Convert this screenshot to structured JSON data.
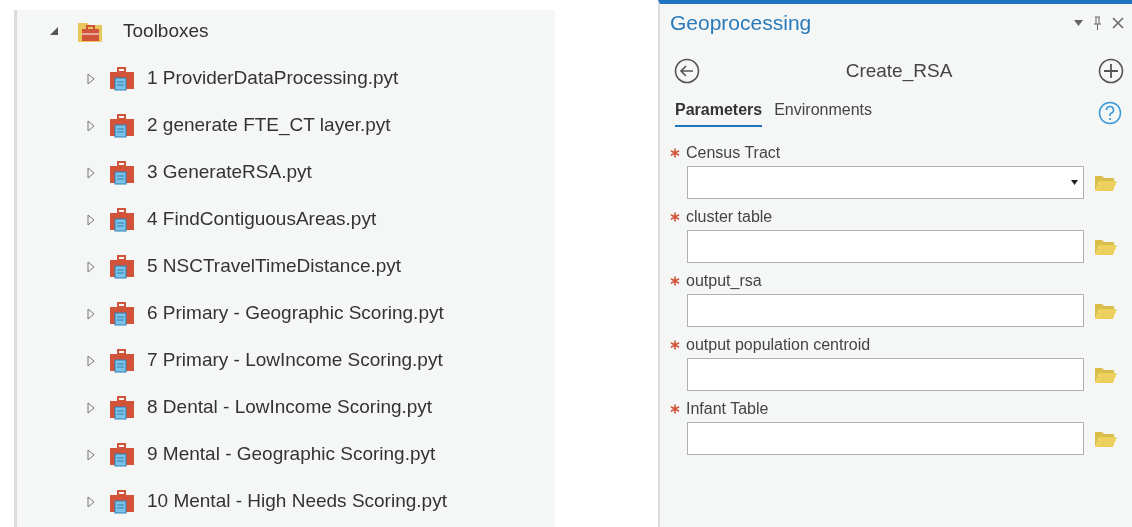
{
  "tree": {
    "label": "Toolboxes",
    "expanded": true,
    "children": [
      {
        "label": "1 ProviderDataProcessing.pyt",
        "expanded": false
      },
      {
        "label": "2 generate FTE_CT layer.pyt",
        "expanded": false
      },
      {
        "label": "3 GenerateRSA.pyt",
        "expanded": false
      },
      {
        "label": "4 FindContiguousAreas.pyt",
        "expanded": false
      },
      {
        "label": "5 NSCTravelTimeDistance.pyt",
        "expanded": false
      },
      {
        "label": "6 Primary - Geographic Scoring.pyt",
        "expanded": false
      },
      {
        "label": "7 Primary - LowIncome Scoring.pyt",
        "expanded": false
      },
      {
        "label": "8 Dental - LowIncome Scoring.pyt",
        "expanded": false
      },
      {
        "label": "9 Mental - Geographic Scoring.pyt",
        "expanded": false
      },
      {
        "label": "10 Mental - High Needs Scoring.pyt",
        "expanded": false
      }
    ]
  },
  "pane": {
    "title": "Geoprocessing",
    "tool": "Create_RSA",
    "tabs": [
      {
        "label": "Parameters",
        "selected": true
      },
      {
        "label": "Environments",
        "selected": false
      }
    ],
    "parameters": [
      {
        "label": "Census Tract",
        "required": true,
        "kind": "dropdown"
      },
      {
        "label": "cluster table",
        "required": true,
        "kind": "text"
      },
      {
        "label": "output_rsa",
        "required": true,
        "kind": "text"
      },
      {
        "label": "output population centroid",
        "required": true,
        "kind": "text"
      },
      {
        "label": "Infant Table",
        "required": true,
        "kind": "text"
      }
    ]
  }
}
